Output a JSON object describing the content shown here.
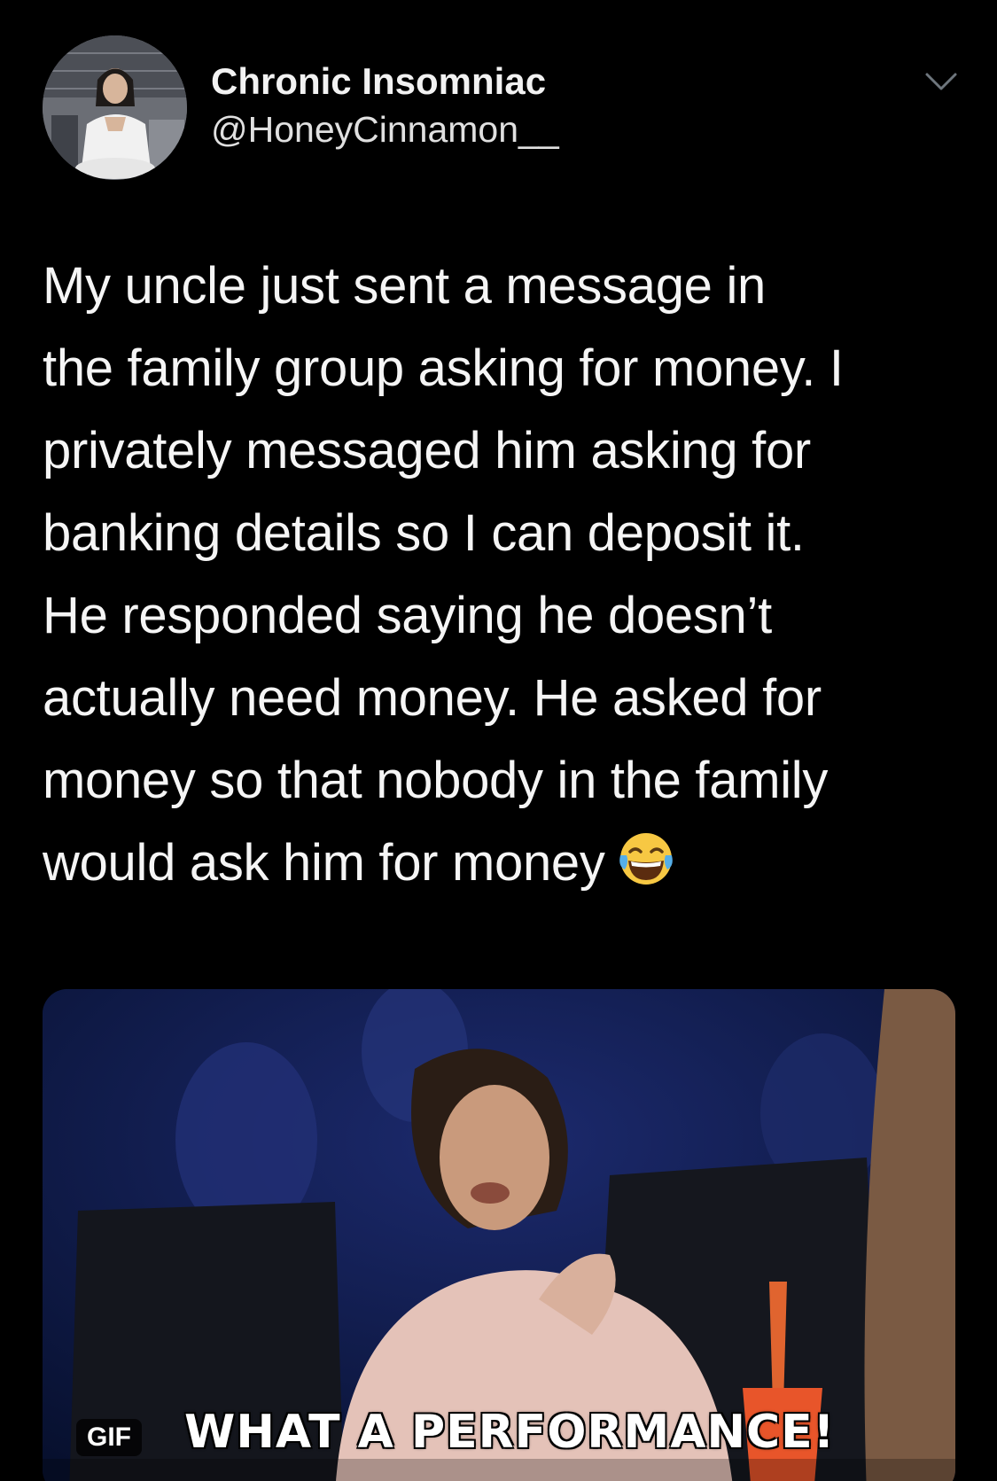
{
  "tweet": {
    "display_name": "Chronic Insomniac",
    "handle": "@HoneyCinnamon__",
    "text": "My uncle just sent a message in\nthe family group asking for money. I\nprivately messaged him asking for\nbanking details so I can deposit it.\nHe responded saying he doesn’t\nactually need money. He asked for\nmoney so that nobody in the family\nwould ask him for money",
    "emoji": "face-with-tears-of-joy"
  },
  "media": {
    "badge": "GIF",
    "caption": "WHAT A PERFORMANCE!"
  },
  "icons": {
    "more": "chevron-down-icon"
  }
}
